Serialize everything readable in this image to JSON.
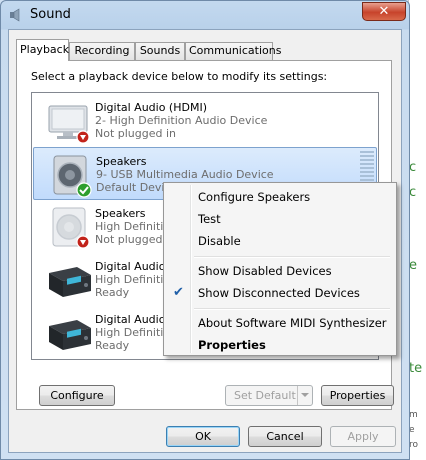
{
  "window": {
    "title": "Sound",
    "close_label": "✕"
  },
  "tabs": [
    {
      "label": "Playback"
    },
    {
      "label": "Recording"
    },
    {
      "label": "Sounds"
    },
    {
      "label": "Communications"
    }
  ],
  "instruction": "Select a playback device below to modify its settings:",
  "devices": [
    {
      "name": "Digital Audio (HDMI)",
      "description": "2- High Definition Audio Device",
      "status": "Not plugged in",
      "icon": "monitor-icon",
      "badge": "unplugged"
    },
    {
      "name": "Speakers",
      "description": "9- USB Multimedia Audio Device",
      "status": "Default Device",
      "icon": "speaker-icon",
      "badge": "default-check"
    },
    {
      "name": "Speakers",
      "description": "High Definition",
      "status": "Not plugged in",
      "icon": "speaker-icon",
      "badge": "unplugged"
    },
    {
      "name": "Digital Audio",
      "description": "High Definition",
      "status": "Ready",
      "icon": "receiver-icon",
      "badge": "none"
    },
    {
      "name": "Digital Audio",
      "description": "High Definition",
      "status": "Ready",
      "icon": "receiver-icon",
      "badge": "none"
    }
  ],
  "panel_buttons": {
    "configure": "Configure",
    "set_default": "Set Default",
    "properties": "Properties"
  },
  "dialog_buttons": {
    "ok": "OK",
    "cancel": "Cancel",
    "apply": "Apply"
  },
  "context_menu": {
    "configure_speakers": "Configure Speakers",
    "test": "Test",
    "disable": "Disable",
    "show_disabled": "Show Disabled Devices",
    "show_disconnected": "Show Disconnected Devices",
    "show_disconnected_checked": true,
    "about_midi": "About Software MIDI Synthesizer",
    "properties": "Properties"
  },
  "colors": {
    "accent_check": "#1f5fa8",
    "close_red": "#c7432b",
    "status_green": "#2e9e2e",
    "unplugged_red": "#c2231b"
  }
}
